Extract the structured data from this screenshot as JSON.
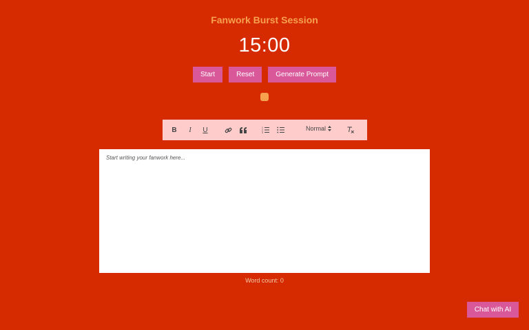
{
  "app": {
    "title": "Fanwork Burst Session",
    "timer": "15:00"
  },
  "controls": {
    "start_label": "Start",
    "reset_label": "Reset",
    "generate_label": "Generate Prompt"
  },
  "toolbar": {
    "bold_label": "B",
    "italic_label": "I",
    "underline_label": "U",
    "format_value": "Normal",
    "buttons": [
      "bold-icon",
      "italic-icon",
      "underline-icon",
      "link-icon",
      "quote-icon",
      "ordered-list-icon",
      "bullet-list-icon",
      "clear-format-icon"
    ]
  },
  "editor": {
    "placeholder": "Start writing your fanwork here..."
  },
  "footer": {
    "word_count": "Word count: 0"
  },
  "chat": {
    "label": "Chat with AI"
  },
  "colors": {
    "background": "#d62a00",
    "title": "#f7a24e",
    "button": "#d9589a",
    "toolbar": "#ffcccc",
    "indicator": "#f7a24e"
  }
}
